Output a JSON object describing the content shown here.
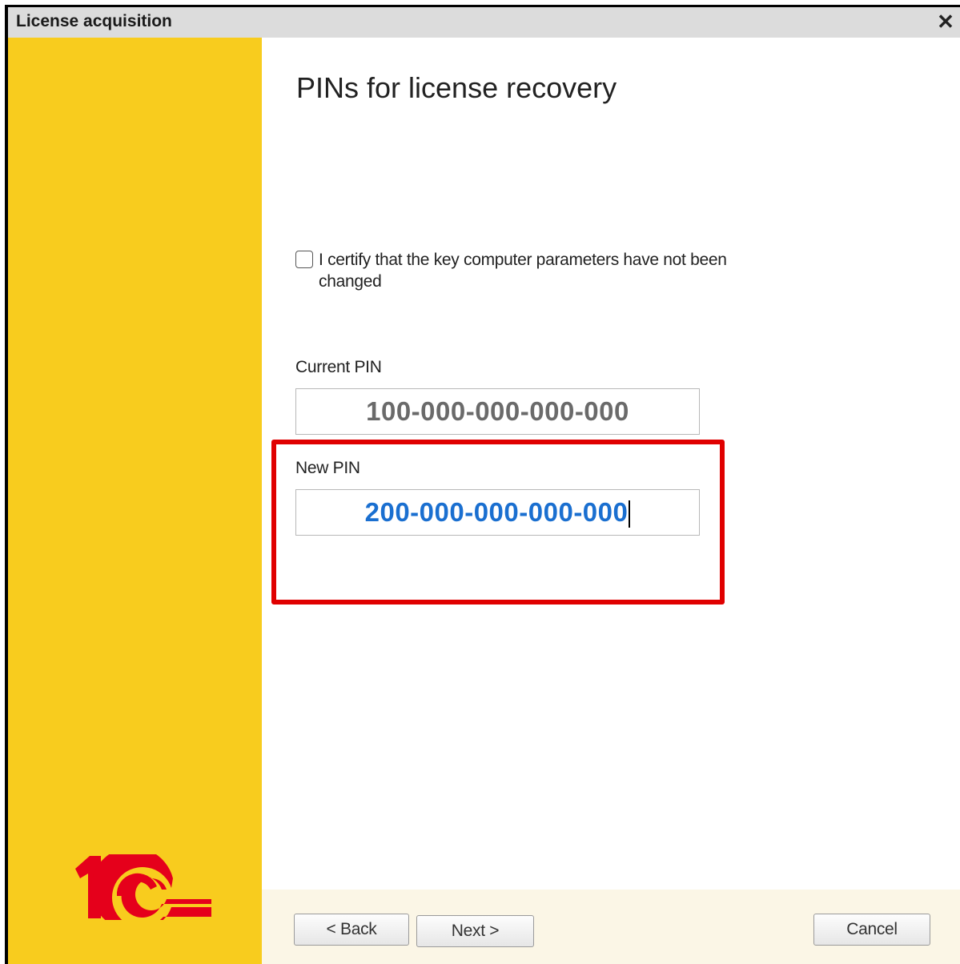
{
  "window": {
    "title": "License acquisition",
    "close_icon": "close-icon"
  },
  "colors": {
    "sidebar": "#f8cc1e",
    "logo": "#e5001b",
    "highlight": "#e00000",
    "new_pin_text": "#1a6fd0"
  },
  "page": {
    "title": "PINs for license recovery",
    "certify": {
      "checked": false,
      "label": "I certify that the key computer parameters have not been changed"
    },
    "current_pin": {
      "label": "Current PIN",
      "value": "100-000-000-000-000"
    },
    "new_pin": {
      "label": "New PIN",
      "value": "200-000-000-000-000"
    }
  },
  "footer": {
    "back_label": "< Back",
    "next_label": "Next >",
    "cancel_label": "Cancel"
  }
}
